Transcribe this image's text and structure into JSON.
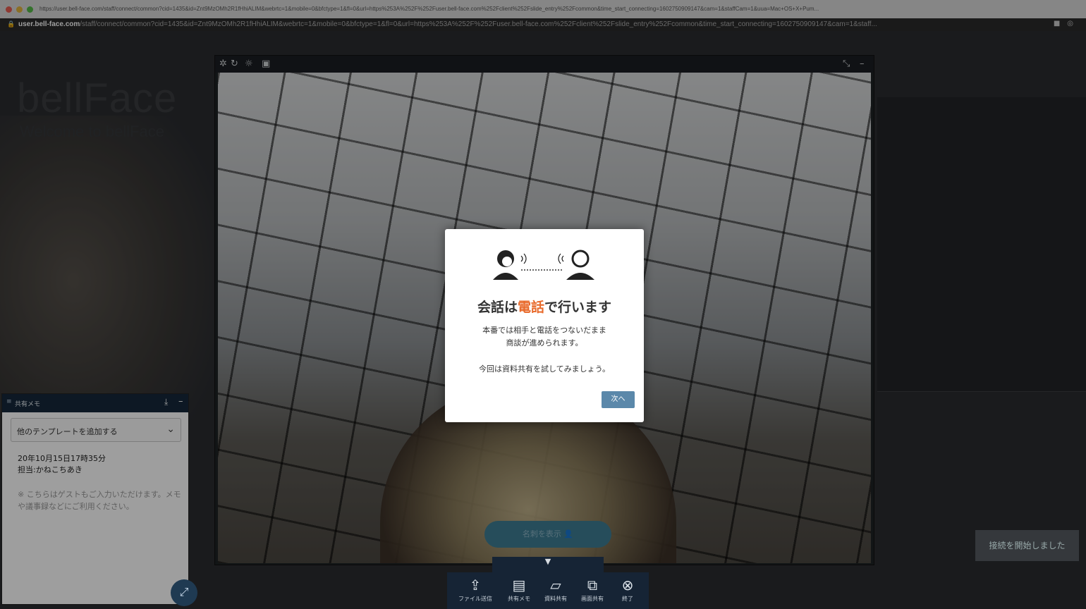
{
  "browser": {
    "url_full": "https://user.bell-face.com/staff/connect/common?cid=1435&id=Znt9MzOMh2R1fHhiALIM&webrtc=1&mobile=0&bfctype=1&fl=0&url=https%253A%252F%252Fuser.bell-face.com%252Fclient%252Fslide_entry%252Fcommon&time_start_connecting=1602750909147&cam=1&staffCam=1&uua=Mac+OS+X+Pum...",
    "domain": "user.bell-face.com",
    "path": "/staff/connect/common?cid=1435&id=Znt9MzOMh2R1fHhiALIM&webrtc=1&mobile=0&bfctype=1&fl=0&url=https%253A%252F%252Fuser.bell-face.com%252Fclient%252Fslide_entry%252Fcommon&time_start_connecting=1602750909147&cam=1&staff..."
  },
  "background": {
    "logo": "bellFace",
    "welcome": "Welcome to bellFace"
  },
  "video": {
    "show_card_label": "名刺を表示"
  },
  "modal": {
    "title_before": "会話は",
    "title_highlight": "電話",
    "title_after": "で行います",
    "body_line1": "本番では相手と電話をつないだまま",
    "body_line2": "商談が進められます。",
    "body_line3": "今回は資料共有を試してみましょう。",
    "next_label": "次へ"
  },
  "memo": {
    "title": "共有メモ",
    "template_select": "他のテンプレートを追加する",
    "date_line": "20年10月15日17時35分",
    "owner_line": "担当:かねこちあき",
    "hint": "※ こちらはゲストもご入力いただけます。メモや議事録などにご利用ください。"
  },
  "status_text": "接続を開始しました",
  "toolbar": {
    "items": [
      {
        "label": "ファイル送信",
        "icon": "upload-icon"
      },
      {
        "label": "共有メモ",
        "icon": "memo-icon"
      },
      {
        "label": "資料共有",
        "icon": "document-share-icon"
      },
      {
        "label": "画面共有",
        "icon": "screen-share-icon"
      },
      {
        "label": "終了",
        "icon": "close-circle-icon"
      }
    ]
  },
  "colors": {
    "accent_orange": "#e8692a",
    "toolbar_navy": "#162435",
    "next_button": "#5b88aa"
  }
}
